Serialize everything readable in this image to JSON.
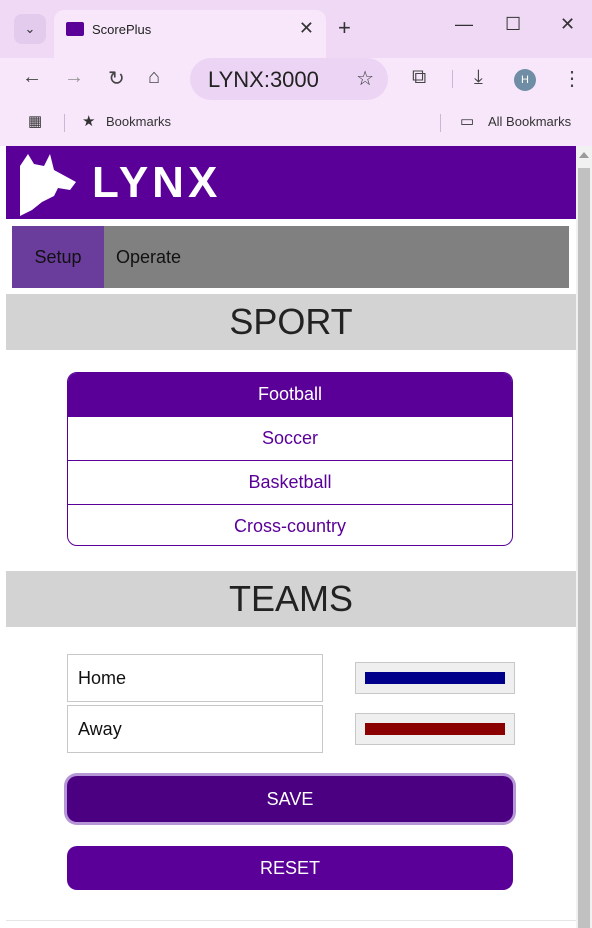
{
  "browser": {
    "tab_title": "ScorePlus",
    "address": "LYNX:3000",
    "profile_initial": "H",
    "bookmarks_label": "Bookmarks",
    "all_bookmarks_label": "All Bookmarks"
  },
  "app": {
    "brand": "LYNX",
    "brand_color": "#5a0099",
    "nav": {
      "setup": "Setup",
      "operate": "Operate",
      "active": "Setup"
    },
    "sport_section": {
      "title": "SPORT",
      "options": [
        "Football",
        "Soccer",
        "Basketball",
        "Cross-country"
      ],
      "selected": "Football"
    },
    "teams_section": {
      "title": "TEAMS",
      "home": {
        "name": "Home",
        "color": "#00008b"
      },
      "away": {
        "name": "Away",
        "color": "#8b0000"
      }
    },
    "buttons": {
      "save": "SAVE",
      "reset": "RESET"
    }
  }
}
